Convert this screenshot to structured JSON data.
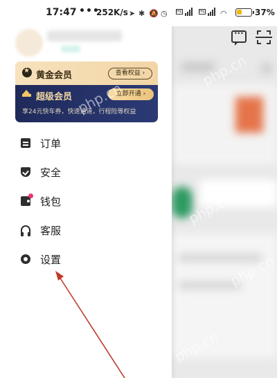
{
  "status_bar": {
    "time": "17:47",
    "dots": "•••",
    "network_speed": "252K/s",
    "battery_percent": "37",
    "battery_level": 0.37,
    "battery_color": "#f2b90c"
  },
  "drawer": {
    "vip": {
      "gold_title": "黄金会员",
      "gold_button": "查看权益 ›",
      "super_title": "超级会员",
      "super_button": "立即开通 ›",
      "super_description": "享24元快车券，快速通道，行程险等权益"
    },
    "menu": [
      {
        "label": "订单",
        "icon": "order-icon"
      },
      {
        "label": "安全",
        "icon": "shield-icon"
      },
      {
        "label": "钱包",
        "icon": "wallet-icon",
        "badge": true
      },
      {
        "label": "客服",
        "icon": "headset-icon"
      },
      {
        "label": "设置",
        "icon": "settings-icon"
      }
    ]
  },
  "top_right_icons": [
    "message-icon",
    "scan-icon"
  ],
  "watermark": "php.cn",
  "colors": {
    "gold_card": "#f4dcb0",
    "super_card": "#25316a",
    "badge": "#f0326b",
    "annotation_arrow": "#c0392b"
  }
}
